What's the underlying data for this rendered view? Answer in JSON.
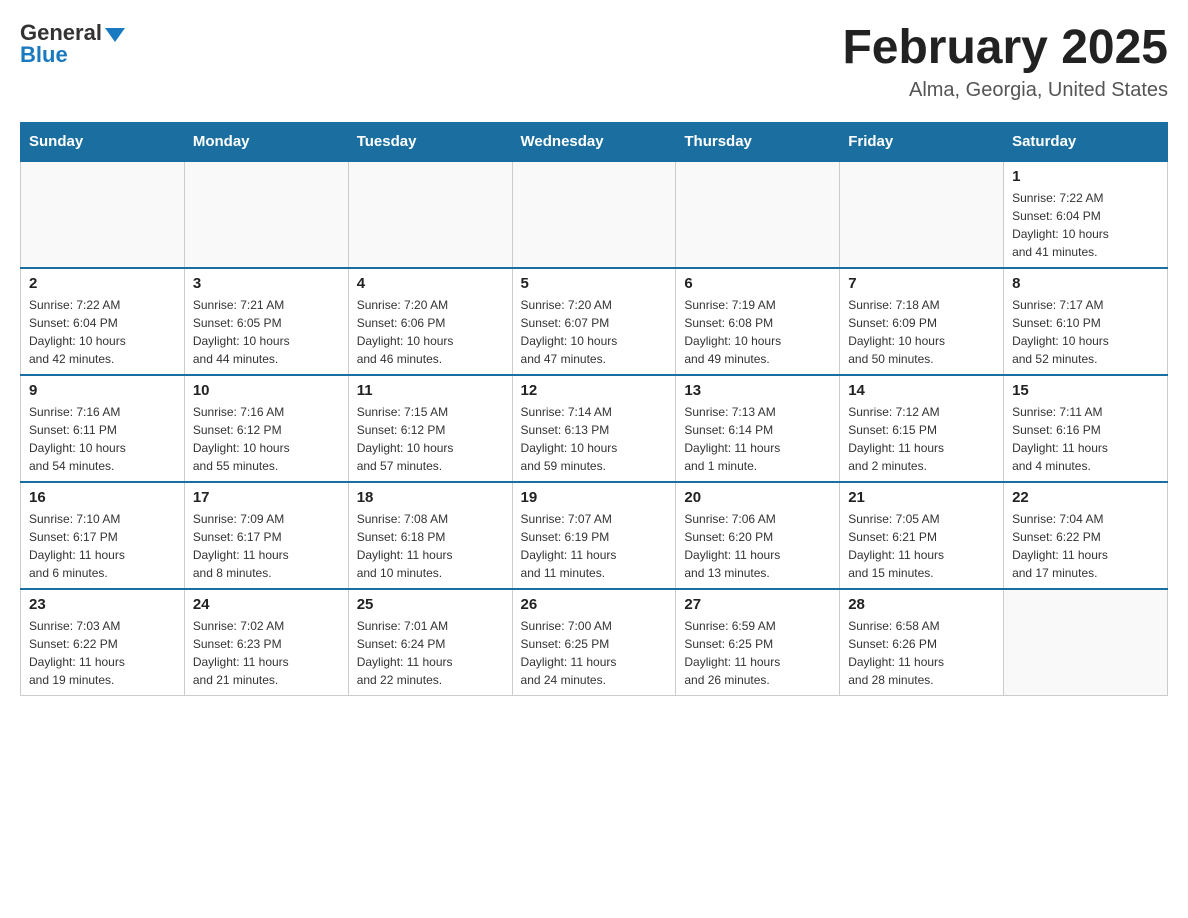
{
  "header": {
    "logo_general": "General",
    "logo_blue": "Blue",
    "title": "February 2025",
    "location": "Alma, Georgia, United States"
  },
  "weekdays": [
    "Sunday",
    "Monday",
    "Tuesday",
    "Wednesday",
    "Thursday",
    "Friday",
    "Saturday"
  ],
  "weeks": [
    [
      {
        "day": "",
        "info": ""
      },
      {
        "day": "",
        "info": ""
      },
      {
        "day": "",
        "info": ""
      },
      {
        "day": "",
        "info": ""
      },
      {
        "day": "",
        "info": ""
      },
      {
        "day": "",
        "info": ""
      },
      {
        "day": "1",
        "info": "Sunrise: 7:22 AM\nSunset: 6:04 PM\nDaylight: 10 hours\nand 41 minutes."
      }
    ],
    [
      {
        "day": "2",
        "info": "Sunrise: 7:22 AM\nSunset: 6:04 PM\nDaylight: 10 hours\nand 42 minutes."
      },
      {
        "day": "3",
        "info": "Sunrise: 7:21 AM\nSunset: 6:05 PM\nDaylight: 10 hours\nand 44 minutes."
      },
      {
        "day": "4",
        "info": "Sunrise: 7:20 AM\nSunset: 6:06 PM\nDaylight: 10 hours\nand 46 minutes."
      },
      {
        "day": "5",
        "info": "Sunrise: 7:20 AM\nSunset: 6:07 PM\nDaylight: 10 hours\nand 47 minutes."
      },
      {
        "day": "6",
        "info": "Sunrise: 7:19 AM\nSunset: 6:08 PM\nDaylight: 10 hours\nand 49 minutes."
      },
      {
        "day": "7",
        "info": "Sunrise: 7:18 AM\nSunset: 6:09 PM\nDaylight: 10 hours\nand 50 minutes."
      },
      {
        "day": "8",
        "info": "Sunrise: 7:17 AM\nSunset: 6:10 PM\nDaylight: 10 hours\nand 52 minutes."
      }
    ],
    [
      {
        "day": "9",
        "info": "Sunrise: 7:16 AM\nSunset: 6:11 PM\nDaylight: 10 hours\nand 54 minutes."
      },
      {
        "day": "10",
        "info": "Sunrise: 7:16 AM\nSunset: 6:12 PM\nDaylight: 10 hours\nand 55 minutes."
      },
      {
        "day": "11",
        "info": "Sunrise: 7:15 AM\nSunset: 6:12 PM\nDaylight: 10 hours\nand 57 minutes."
      },
      {
        "day": "12",
        "info": "Sunrise: 7:14 AM\nSunset: 6:13 PM\nDaylight: 10 hours\nand 59 minutes."
      },
      {
        "day": "13",
        "info": "Sunrise: 7:13 AM\nSunset: 6:14 PM\nDaylight: 11 hours\nand 1 minute."
      },
      {
        "day": "14",
        "info": "Sunrise: 7:12 AM\nSunset: 6:15 PM\nDaylight: 11 hours\nand 2 minutes."
      },
      {
        "day": "15",
        "info": "Sunrise: 7:11 AM\nSunset: 6:16 PM\nDaylight: 11 hours\nand 4 minutes."
      }
    ],
    [
      {
        "day": "16",
        "info": "Sunrise: 7:10 AM\nSunset: 6:17 PM\nDaylight: 11 hours\nand 6 minutes."
      },
      {
        "day": "17",
        "info": "Sunrise: 7:09 AM\nSunset: 6:17 PM\nDaylight: 11 hours\nand 8 minutes."
      },
      {
        "day": "18",
        "info": "Sunrise: 7:08 AM\nSunset: 6:18 PM\nDaylight: 11 hours\nand 10 minutes."
      },
      {
        "day": "19",
        "info": "Sunrise: 7:07 AM\nSunset: 6:19 PM\nDaylight: 11 hours\nand 11 minutes."
      },
      {
        "day": "20",
        "info": "Sunrise: 7:06 AM\nSunset: 6:20 PM\nDaylight: 11 hours\nand 13 minutes."
      },
      {
        "day": "21",
        "info": "Sunrise: 7:05 AM\nSunset: 6:21 PM\nDaylight: 11 hours\nand 15 minutes."
      },
      {
        "day": "22",
        "info": "Sunrise: 7:04 AM\nSunset: 6:22 PM\nDaylight: 11 hours\nand 17 minutes."
      }
    ],
    [
      {
        "day": "23",
        "info": "Sunrise: 7:03 AM\nSunset: 6:22 PM\nDaylight: 11 hours\nand 19 minutes."
      },
      {
        "day": "24",
        "info": "Sunrise: 7:02 AM\nSunset: 6:23 PM\nDaylight: 11 hours\nand 21 minutes."
      },
      {
        "day": "25",
        "info": "Sunrise: 7:01 AM\nSunset: 6:24 PM\nDaylight: 11 hours\nand 22 minutes."
      },
      {
        "day": "26",
        "info": "Sunrise: 7:00 AM\nSunset: 6:25 PM\nDaylight: 11 hours\nand 24 minutes."
      },
      {
        "day": "27",
        "info": "Sunrise: 6:59 AM\nSunset: 6:25 PM\nDaylight: 11 hours\nand 26 minutes."
      },
      {
        "day": "28",
        "info": "Sunrise: 6:58 AM\nSunset: 6:26 PM\nDaylight: 11 hours\nand 28 minutes."
      },
      {
        "day": "",
        "info": ""
      }
    ]
  ]
}
